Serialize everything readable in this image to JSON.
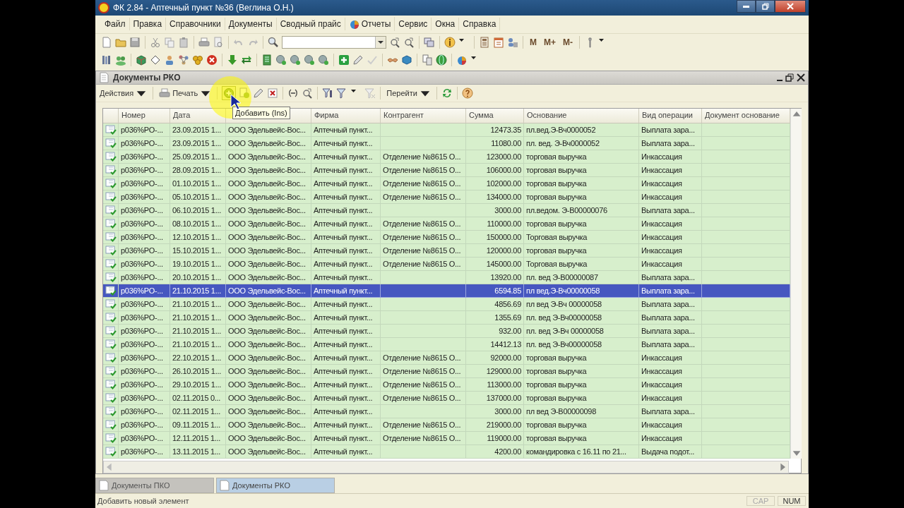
{
  "window": {
    "title": "ФК 2.84 - Аптечный пункт №36 (Веглина О.Н.)"
  },
  "menu": [
    {
      "label": "Файл"
    },
    {
      "label": "Правка"
    },
    {
      "label": "Справочники"
    },
    {
      "label": "Документы"
    },
    {
      "label": "Сводный прайс"
    },
    {
      "label": "Отчеты",
      "kind": "icon"
    },
    {
      "label": "Сервис"
    },
    {
      "label": "Окна"
    },
    {
      "label": "Справка"
    }
  ],
  "memory_buttons": [
    "M",
    "M+",
    "M-"
  ],
  "document_window": {
    "title": "Документы РКО",
    "toolbar": [
      {
        "label": "Действия",
        "kind": "dropdown"
      },
      {
        "label": "Печать",
        "kind": "print"
      },
      {
        "label": "Перейти",
        "kind": "dropdown"
      }
    ],
    "tooltip": "Добавить (Ins)",
    "columns": [
      {
        "title": "Номер"
      },
      {
        "title": "Дата"
      },
      {},
      {
        "title": "Фирма"
      },
      {
        "title": "Контрагент"
      },
      {
        "title": "Сумма"
      },
      {
        "title": "Основание"
      },
      {
        "title": "Вид операции"
      },
      {
        "title": "Документ основание"
      }
    ],
    "rows": [
      {
        "selected": false,
        "number": "p036%PO-...",
        "date": "23.09.2015 1...",
        "column_3": "ООО Эдельвейс-Вос...",
        "firm": "Аптечный пункт...",
        "amount": "12473.35",
        "basis": "пл.вед.Э-Вч0000052",
        "operation": "Выплата зара..."
      },
      {
        "selected": false,
        "number": "p036%PO-...",
        "date": "23.09.2015 1...",
        "column_3": "ООО Эдельвейс-Вос...",
        "firm": "Аптечный пункт...",
        "amount": "11080.00",
        "basis": "пл. вед. Э-Вч0000052",
        "operation": "Выплата зара..."
      },
      {
        "selected": false,
        "number": "p036%PO-...",
        "date": "25.09.2015 1...",
        "column_3": "ООО Эдельвейс-Вос...",
        "firm": "Аптечный пункт...",
        "counterparty": "Отделение №8615 О...",
        "amount": "123000.00",
        "basis": "торговая выручка",
        "operation": "Инкассация"
      },
      {
        "selected": false,
        "number": "p036%PO-...",
        "date": "28.09.2015 1...",
        "column_3": "ООО Эдельвейс-Вос...",
        "firm": "Аптечный пункт...",
        "counterparty": "Отделение №8615 О...",
        "amount": "106000.00",
        "basis": "торговая выручка",
        "operation": "Инкассация"
      },
      {
        "selected": false,
        "number": "p036%PO-...",
        "date": "01.10.2015 1...",
        "column_3": "ООО Эдельвейс-Вос...",
        "firm": "Аптечный пункт...",
        "counterparty": "Отделение №8615 О...",
        "amount": "102000.00",
        "basis": "торговая выручка",
        "operation": "Инкассация"
      },
      {
        "selected": false,
        "number": "p036%PO-...",
        "date": "05.10.2015 1...",
        "column_3": "ООО Эдельвейс-Вос...",
        "firm": "Аптечный пункт...",
        "counterparty": "Отделение №8615 О...",
        "amount": "134000.00",
        "basis": "торговая выручка",
        "operation": "Инкассация"
      },
      {
        "selected": false,
        "number": "p036%PO-...",
        "date": "06.10.2015 1...",
        "column_3": "ООО Эдельвейс-Вос...",
        "firm": "Аптечный пункт...",
        "amount": "3000.00",
        "basis": "пл.ведом. Э-В00000076",
        "operation": "Выплата зара..."
      },
      {
        "selected": false,
        "number": "p036%PO-...",
        "date": "08.10.2015 1...",
        "column_3": "ООО Эдельвейс-Вос...",
        "firm": "Аптечный пункт...",
        "counterparty": "Отделение №8615 О...",
        "amount": "110000.00",
        "basis": "торговая выручка",
        "operation": "Инкассация"
      },
      {
        "selected": false,
        "number": "p036%PO-...",
        "date": "12.10.2015 1...",
        "column_3": "ООО Эдельвейс-Вос...",
        "firm": "Аптечный пункт...",
        "counterparty": "Отделение №8615 О...",
        "amount": "150000.00",
        "basis": "Торговая выручка",
        "operation": "Инкассация"
      },
      {
        "selected": false,
        "number": "p036%PO-...",
        "date": "15.10.2015 1...",
        "column_3": "ООО Эдельвейс-Вос...",
        "firm": "Аптечный пункт...",
        "counterparty": "Отделение №8615 О...",
        "amount": "120000.00",
        "basis": "торговая выручка",
        "operation": "Инкассация"
      },
      {
        "selected": false,
        "number": "p036%PO-...",
        "date": "19.10.2015 1...",
        "column_3": "ООО Эдельвейс-Вос...",
        "firm": "Аптечный пункт...",
        "counterparty": "Отделение №8615 О...",
        "amount": "145000.00",
        "basis": "Торговая выручка",
        "operation": "Инкассация"
      },
      {
        "selected": false,
        "number": "p036%PO-...",
        "date": "20.10.2015 1...",
        "column_3": "ООО Эдельвейс-Вос...",
        "firm": "Аптечный пункт...",
        "amount": "13920.00",
        "basis": "пл. вед Э-В00000087",
        "operation": "Выплата зара..."
      },
      {
        "selected": true,
        "number": "p036%PO-...",
        "date": "21.10.2015 1...",
        "column_3": "ООО Эдельвейс-Вос...",
        "firm": "Аптечный пункт...",
        "amount": "6594.85",
        "basis": "пл вед.Э-Вч00000058",
        "operation": "Выплата зара..."
      },
      {
        "selected": false,
        "number": "p036%PO-...",
        "date": "21.10.2015 1...",
        "column_3": "ООО Эдельвейс-Вос...",
        "firm": "Аптечный пункт...",
        "amount": "4856.69",
        "basis": "пл вед Э-Вч 00000058",
        "operation": "Выплата зара..."
      },
      {
        "selected": false,
        "number": "p036%PO-...",
        "date": "21.10.2015 1...",
        "column_3": "ООО Эдельвейс-Вос...",
        "firm": "Аптечный пункт...",
        "amount": "1355.69",
        "basis": "пл. вед Э-Вч00000058",
        "operation": "Выплата зара..."
      },
      {
        "selected": false,
        "number": "p036%PO-...",
        "date": "21.10.2015 1...",
        "column_3": "ООО Эдельвейс-Вос...",
        "firm": "Аптечный пункт...",
        "amount": "932.00",
        "basis": "пл. вед Э-Вч 00000058",
        "operation": "Выплата зара..."
      },
      {
        "selected": false,
        "number": "p036%PO-...",
        "date": "21.10.2015 1...",
        "column_3": "ООО Эдельвейс-Вос...",
        "firm": "Аптечный пункт...",
        "amount": "14412.13",
        "basis": "пл. вед Э-Вч00000058",
        "operation": "Выплата зара..."
      },
      {
        "selected": false,
        "number": "p036%PO-...",
        "date": "22.10.2015 1...",
        "column_3": "ООО Эдельвейс-Вос...",
        "firm": "Аптечный пункт...",
        "counterparty": "Отделение №8615 О...",
        "amount": "92000.00",
        "basis": "торговая выручка",
        "operation": "Инкассация"
      },
      {
        "selected": false,
        "number": "p036%PO-...",
        "date": "26.10.2015 1...",
        "column_3": "ООО Эдельвейс-Вос...",
        "firm": "Аптечный пункт...",
        "counterparty": "Отделение №8615 О...",
        "amount": "129000.00",
        "basis": "торговая выручка",
        "operation": "Инкассация"
      },
      {
        "selected": false,
        "number": "p036%PO-...",
        "date": "29.10.2015 1...",
        "column_3": "ООО Эдельвейс-Вос...",
        "firm": "Аптечный пункт...",
        "counterparty": "Отделение №8615 О...",
        "amount": "113000.00",
        "basis": "торговая выручка",
        "operation": "Инкассация"
      },
      {
        "selected": false,
        "number": "p036%PO-...",
        "date": "02.11.2015 0...",
        "column_3": "ООО Эдельвейс-Вос...",
        "firm": "Аптечный пункт...",
        "counterparty": "Отделение №8615 О...",
        "amount": "137000.00",
        "basis": "торговая выручка",
        "operation": "Инкассация"
      },
      {
        "selected": false,
        "number": "p036%PO-...",
        "date": "02.11.2015 1...",
        "column_3": "ООО Эдельвейс-Вос...",
        "firm": "Аптечный пункт...",
        "amount": "3000.00",
        "basis": "пл вед Э-В00000098",
        "operation": "Выплата зара..."
      },
      {
        "selected": false,
        "number": "p036%PO-...",
        "date": "09.11.2015 1...",
        "column_3": "ООО Эдельвейс-Вос...",
        "firm": "Аптечный пункт...",
        "counterparty": "Отделение №8615 О...",
        "amount": "219000.00",
        "basis": "торговая выручка",
        "operation": "Инкассация"
      },
      {
        "selected": false,
        "number": "p036%PO-...",
        "date": "12.11.2015 1...",
        "column_3": "ООО Эдельвейс-Вос...",
        "firm": "Аптечный пункт...",
        "counterparty": "Отделение №8615 О...",
        "amount": "119000.00",
        "basis": "торговая выручка",
        "operation": "Инкассация"
      },
      {
        "selected": false,
        "number": "p036%PO-...",
        "date": "13.11.2015 1...",
        "column_3": "ООО Эдельвейс-Вос...",
        "firm": "Аптечный пункт...",
        "amount": "4200.00",
        "basis": "командировка с 16.11  по 21...",
        "operation": "Выдача подот..."
      }
    ]
  },
  "window_tabs": [
    {
      "label": "Документы ПКО",
      "selected": false
    },
    {
      "label": "Документы РКО",
      "selected": true
    }
  ],
  "status_bar": {
    "message": "Добавить новый элемент",
    "indicators": [
      {
        "label": "CAP",
        "on": false
      },
      {
        "label": "NUM",
        "on": true
      }
    ]
  }
}
